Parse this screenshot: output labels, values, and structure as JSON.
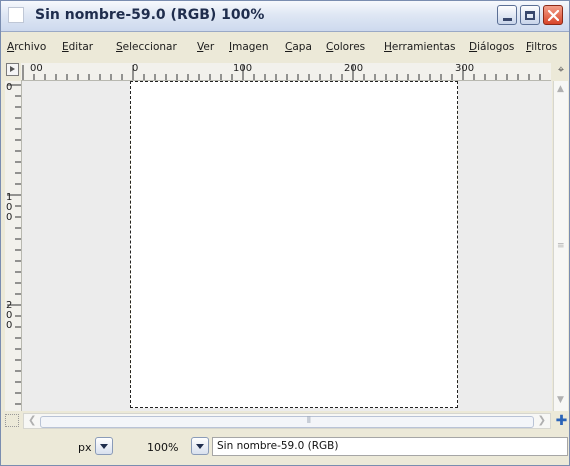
{
  "window": {
    "title": "Sin nombre-59.0 (RGB) 100%"
  },
  "menu": [
    {
      "label": "Archivo",
      "mnemonic": "A",
      "rest": "rchivo"
    },
    {
      "label": "Editar",
      "mnemonic": "E",
      "rest": "ditar"
    },
    {
      "label": "Seleccionar",
      "mnemonic": "S",
      "rest": "eleccionar"
    },
    {
      "label": "Ver",
      "mnemonic": "V",
      "rest": "er"
    },
    {
      "label": "Imagen",
      "mnemonic": "I",
      "rest": "magen"
    },
    {
      "label": "Capa",
      "mnemonic": "C",
      "rest": "apa"
    },
    {
      "label": "Colores",
      "mnemonic": "C",
      "rest": "olores"
    },
    {
      "label": "Herramientas",
      "mnemonic": "H",
      "rest": "erramientas"
    },
    {
      "label": "Diálogos",
      "mnemonic": "D",
      "rest": "iálogos"
    },
    {
      "label": "Filtros",
      "mnemonic": "F",
      "rest": "iltros"
    }
  ],
  "ruler": {
    "horizontal_labels": [
      "00",
      "0",
      "100",
      "200",
      "300"
    ],
    "vertical_labels": [
      "0",
      "100",
      "200"
    ]
  },
  "statusbar": {
    "unit": "px",
    "zoom": "100%",
    "image_info": "Sin nombre-59.0 (RGB)"
  },
  "icons": {
    "app": "gimp-image-window-icon",
    "minimize": "minimize-icon",
    "maximize": "maximize-icon",
    "close": "close-icon",
    "navigate": "navigate-icon",
    "move": "move-icon",
    "quick_mask": "quick-mask-icon"
  },
  "colors": {
    "selection_marching_ants": "#d2b000",
    "canvas_background": "#ececec",
    "image_fill": "#ffffff",
    "close_button": "#d8452a"
  }
}
